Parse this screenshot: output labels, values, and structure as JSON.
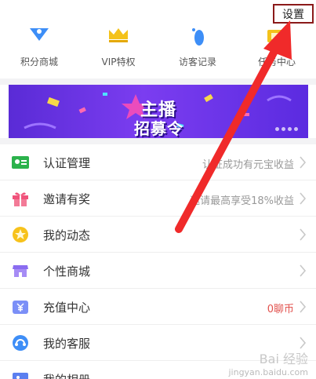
{
  "header": {
    "settings_label": "设置"
  },
  "quick_actions": [
    {
      "label": "积分商城",
      "icon": "points-shield-icon"
    },
    {
      "label": "VIP特权",
      "icon": "crown-icon"
    },
    {
      "label": "访客记录",
      "icon": "footprint-icon"
    },
    {
      "label": "任务中心",
      "icon": "task-icon"
    }
  ],
  "banner": {
    "line1": "主播",
    "line2": "招募令",
    "page_count": 4
  },
  "menu": [
    {
      "label": "认证管理",
      "value": "认证成功有元宝收益",
      "icon": "id-card-icon",
      "color": "#2bb24c"
    },
    {
      "label": "邀请有奖",
      "value": "邀请最高享受18%收益",
      "icon": "gift-icon",
      "color": "#f0527a"
    },
    {
      "label": "我的动态",
      "value": "",
      "icon": "star-icon",
      "color": "#f7c21b"
    },
    {
      "label": "个性商城",
      "value": "",
      "icon": "shop-icon",
      "color": "#8a6cf0"
    },
    {
      "label": "充值中心",
      "value": "0聊币",
      "icon": "yen-icon",
      "color": "#7b8ff7"
    },
    {
      "label": "我的客服",
      "value": "",
      "icon": "service-icon",
      "color": "#3e8ef7"
    },
    {
      "label": "我的相册",
      "value": "",
      "icon": "album-icon",
      "color": "#5b7ff0"
    }
  ],
  "watermark": {
    "line1": "Bai 经验",
    "line2": "jingyan.baidu.com"
  },
  "colors": {
    "accent_red": "#e2524e",
    "arrow_red": "#f02a2a",
    "banner_purple": "#6a35e8"
  }
}
